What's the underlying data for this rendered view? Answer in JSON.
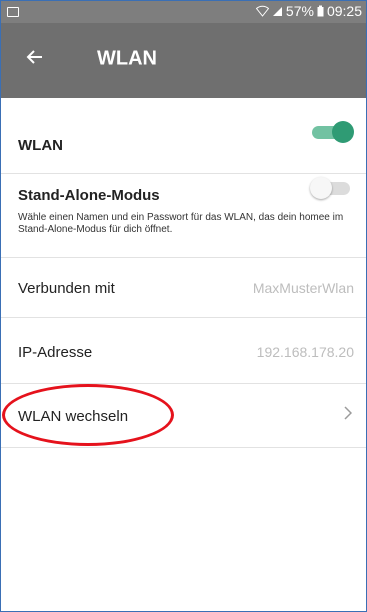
{
  "statusbar": {
    "wifi_icon": "wifi-icon",
    "signal_icon": "signal-icon",
    "battery_percent": "57%",
    "battery_icon": "battery-icon",
    "time": "09:25"
  },
  "toolbar": {
    "back_icon": "arrow-left-icon",
    "title": "WLAN"
  },
  "settings": {
    "wlan": {
      "label": "WLAN",
      "enabled": true
    },
    "standalone": {
      "label": "Stand-Alone-Modus",
      "enabled": false,
      "description": "Wähle einen Namen und ein Passwort für das WLAN, das dein homee im Stand-Alone-Modus für dich öffnet."
    },
    "connected": {
      "label": "Verbunden mit",
      "value": "MaxMusterWlan"
    },
    "ip": {
      "label": "IP-Adresse",
      "value": "192.168.178.20"
    },
    "switch": {
      "label": "WLAN wechseln",
      "chevron_icon": "chevron-right-icon"
    }
  },
  "colors": {
    "toolbar": "#6f6f6f",
    "statusbar": "#7e7e7e",
    "toggle_on": "#2f9b74",
    "highlight": "#e5121c"
  }
}
